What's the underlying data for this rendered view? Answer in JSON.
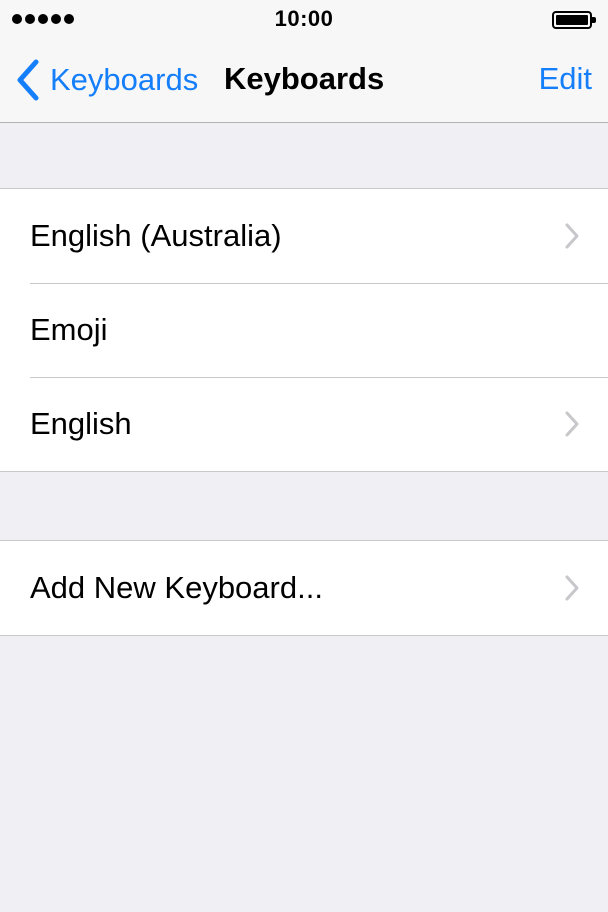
{
  "status_bar": {
    "time": "10:00",
    "signal_bars": 5,
    "battery_level": 1.0
  },
  "nav": {
    "back_label": "Keyboards",
    "title": "Keyboards",
    "edit_label": "Edit"
  },
  "keyboards": [
    {
      "label": "English (Australia)",
      "has_chevron": true
    },
    {
      "label": "Emoji",
      "has_chevron": false
    },
    {
      "label": "English",
      "has_chevron": true
    }
  ],
  "add_keyboard": {
    "label": "Add New Keyboard...",
    "has_chevron": true
  },
  "colors": {
    "accent": "#157efb",
    "background": "#efeff4",
    "separator": "#c8c7cc",
    "chevron": "#c7c7cc"
  },
  "icons": {
    "back": "chevron-left-icon",
    "row": "chevron-right-icon"
  }
}
